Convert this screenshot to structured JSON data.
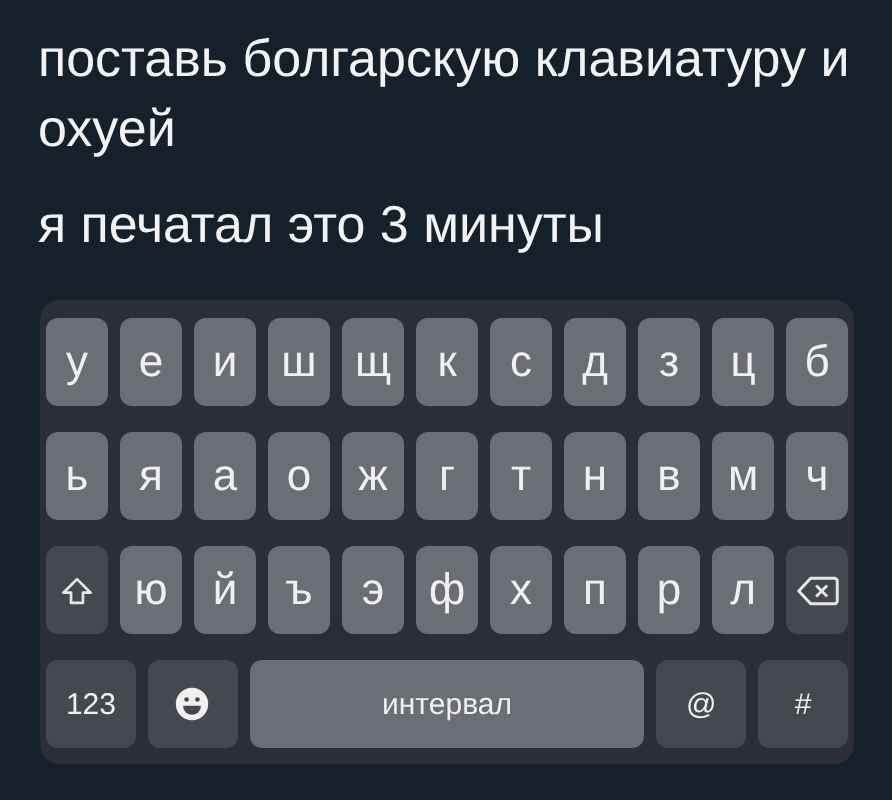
{
  "post": {
    "paragraphs": [
      "поставь болгарскую клавиатуру и охуей",
      "я печатал это 3 минуты"
    ]
  },
  "keyboard": {
    "rows": [
      [
        {
          "kind": "letter",
          "label": "у"
        },
        {
          "kind": "letter",
          "label": "е"
        },
        {
          "kind": "letter",
          "label": "и"
        },
        {
          "kind": "letter",
          "label": "ш"
        },
        {
          "kind": "letter",
          "label": "щ"
        },
        {
          "kind": "letter",
          "label": "к"
        },
        {
          "kind": "letter",
          "label": "с"
        },
        {
          "kind": "letter",
          "label": "д"
        },
        {
          "kind": "letter",
          "label": "з"
        },
        {
          "kind": "letter",
          "label": "ц"
        },
        {
          "kind": "letter",
          "label": "б"
        }
      ],
      [
        {
          "kind": "letter",
          "label": "ь"
        },
        {
          "kind": "letter",
          "label": "я"
        },
        {
          "kind": "letter",
          "label": "а"
        },
        {
          "kind": "letter",
          "label": "о"
        },
        {
          "kind": "letter",
          "label": "ж"
        },
        {
          "kind": "letter",
          "label": "г"
        },
        {
          "kind": "letter",
          "label": "т"
        },
        {
          "kind": "letter",
          "label": "н"
        },
        {
          "kind": "letter",
          "label": "в"
        },
        {
          "kind": "letter",
          "label": "м"
        },
        {
          "kind": "letter",
          "label": "ч"
        }
      ],
      [
        {
          "kind": "shift"
        },
        {
          "kind": "letter",
          "label": "ю"
        },
        {
          "kind": "letter",
          "label": "й"
        },
        {
          "kind": "letter",
          "label": "ъ"
        },
        {
          "kind": "letter",
          "label": "э"
        },
        {
          "kind": "letter",
          "label": "ф"
        },
        {
          "kind": "letter",
          "label": "х"
        },
        {
          "kind": "letter",
          "label": "п"
        },
        {
          "kind": "letter",
          "label": "р"
        },
        {
          "kind": "letter",
          "label": "л"
        },
        {
          "kind": "backspace"
        }
      ]
    ],
    "bottom_row": [
      {
        "kind": "mode",
        "label": "123"
      },
      {
        "kind": "emoji"
      },
      {
        "kind": "space",
        "label": "интервал"
      },
      {
        "kind": "symbol",
        "label": "@"
      },
      {
        "kind": "symbol",
        "label": "#"
      }
    ]
  }
}
